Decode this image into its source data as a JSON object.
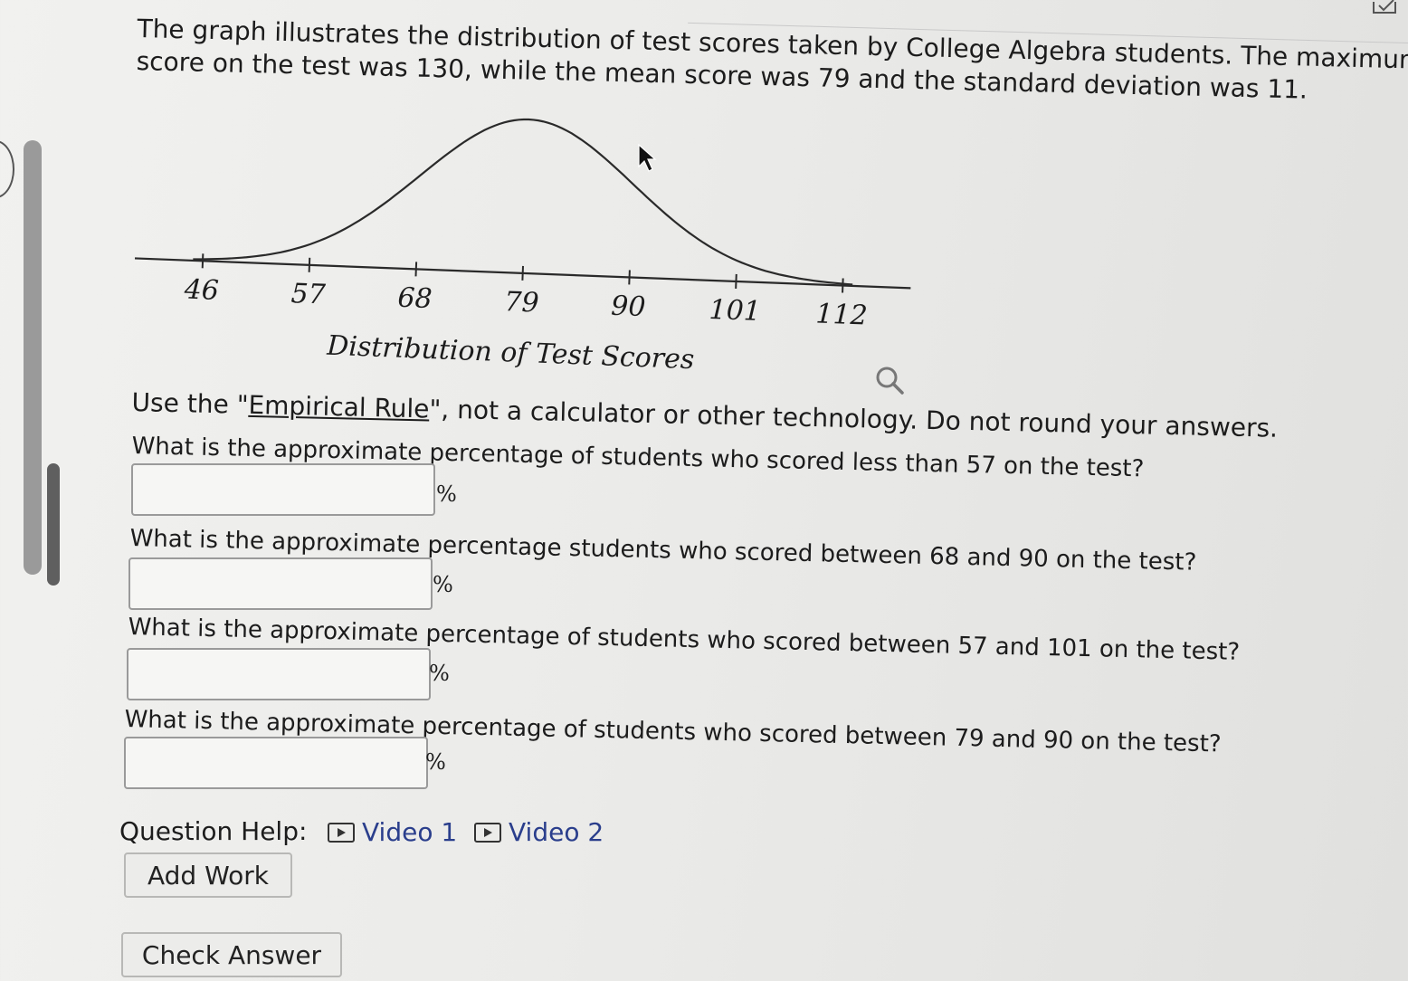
{
  "problem": {
    "intro_line1": "The graph illustrates the distribution of test scores taken by College Algebra students. The maximum pos",
    "intro_line2": "score on the test was 130, while the mean score was 79 and the standard deviation was 11."
  },
  "chart_data": {
    "type": "line",
    "description": "normal distribution curve",
    "mean": 79,
    "std_dev": 11,
    "x_ticks": [
      "46",
      "57",
      "68",
      "79",
      "90",
      "101",
      "112"
    ],
    "x_tick_values": [
      46,
      57,
      68,
      79,
      90,
      101,
      112
    ],
    "xlabel": "Distribution of Test Scores",
    "xlim": [
      39,
      119
    ]
  },
  "instructions": {
    "prefix": "Use the \"",
    "link": "Empirical Rule",
    "suffix": "\", not a calculator or other technology. Do not round your answers."
  },
  "questions": [
    {
      "text": "What is the approximate percentage of students who scored less than 57 on the test?",
      "value": "",
      "unit": "%"
    },
    {
      "text": "What is the approximate percentage students who scored between 68 and 90 on the test?",
      "value": "",
      "unit": "%"
    },
    {
      "text": "What is the approximate percentage of students who scored between 57 and 101 on the test?",
      "value": "",
      "unit": "%"
    },
    {
      "text": "What is the approximate percentage of students who scored between 79 and 90 on the test?",
      "value": "",
      "unit": "%"
    }
  ],
  "help": {
    "label": "Question Help:",
    "video1": "Video 1",
    "video2": "Video 2"
  },
  "buttons": {
    "add_work": "Add Work",
    "check_answer": "Check Answer"
  },
  "icons": {
    "search": "search-icon",
    "video": "video-icon",
    "cursor": "cursor-arrow-icon"
  }
}
